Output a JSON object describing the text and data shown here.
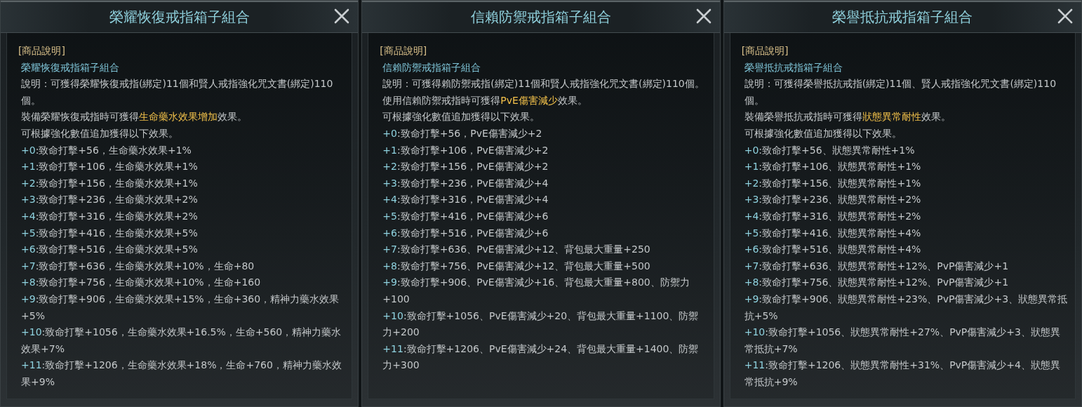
{
  "panels": [
    {
      "title": "榮耀恢復戒指箱子組合",
      "section_heading": "[商品說明]",
      "item_name": "榮耀恢復戒指箱子組合",
      "description": "說明：可獲得榮耀恢復戒指(綁定)11個和賢人戒指強化咒文書(綁定)110個。",
      "effect": {
        "before": "裝備榮耀恢復戒指時可獲得",
        "highlight": "生命藥水效果增加",
        "after": "效果。"
      },
      "note": "可根據強化數值追加獲得以下效果。",
      "levels": [
        {
          "level": "+0",
          "text": ":致命打擊+56，生命藥水效果+1%"
        },
        {
          "level": "+1",
          "text": ":致命打擊+106，生命藥水效果+1%"
        },
        {
          "level": "+2",
          "text": ":致命打擊+156，生命藥水效果+1%"
        },
        {
          "level": "+3",
          "text": ":致命打擊+236，生命藥水效果+2%"
        },
        {
          "level": "+4",
          "text": ":致命打擊+316，生命藥水效果+2%"
        },
        {
          "level": "+5",
          "text": ":致命打擊+416，生命藥水效果+5%"
        },
        {
          "level": "+6",
          "text": ":致命打擊+516，生命藥水效果+5%"
        },
        {
          "level": "+7",
          "text": ":致命打擊+636，生命藥水效果+10%，生命+80"
        },
        {
          "level": "+8",
          "text": ":致命打擊+756，生命藥水效果+10%，生命+160"
        },
        {
          "level": "+9",
          "text": ":致命打擊+906，生命藥水效果+15%，生命+360，精神力藥水效果+5%"
        },
        {
          "level": "+10",
          "text": ":致命打擊+1056，生命藥水效果+16.5%，生命+560，精神力藥水效果+7%"
        },
        {
          "level": "+11",
          "text": ":致命打擊+1206，生命藥水效果+18%，生命+760，精神力藥水效果+9%"
        }
      ]
    },
    {
      "title": "信賴防禦戒指箱子組合",
      "section_heading": "[商品說明]",
      "item_name": "信賴防禦戒指箱子組合",
      "description": "說明：可獲得賴防禦戒指(綁定)11個和賢人戒指強化咒文書(綁定)110個。",
      "effect": {
        "before": "使用信賴防禦戒指時可獲得",
        "highlight": "PvE傷害減少",
        "after": "效果。"
      },
      "note": "可根據強化數值追加獲得以下效果。",
      "levels": [
        {
          "level": "+0",
          "text": ":致命打擊+56，PvE傷害減少+2"
        },
        {
          "level": "+1",
          "text": ":致命打擊+106，PvE傷害減少+2"
        },
        {
          "level": "+2",
          "text": ":致命打擊+156，PvE傷害減少+2"
        },
        {
          "level": "+3",
          "text": ":致命打擊+236，PvE傷害減少+4"
        },
        {
          "level": "+4",
          "text": ":致命打擊+316，PvE傷害減少+4"
        },
        {
          "level": "+5",
          "text": ":致命打擊+416，PvE傷害減少+6"
        },
        {
          "level": "+6",
          "text": ":致命打擊+516，PvE傷害減少+6"
        },
        {
          "level": "+7",
          "text": ":致命打擊+636、PvE傷害減少+12、背包最大重量+250"
        },
        {
          "level": "+8",
          "text": ":致命打擊+756、PvE傷害減少+12、背包最大重量+500"
        },
        {
          "level": "+9",
          "text": ":致命打擊+906、PvE傷害減少+16、背包最大重量+800、防禦力+100"
        },
        {
          "level": "+10",
          "text": ":致命打擊+1056、PvE傷害減少+20、背包最大重量+1100、防禦力+200"
        },
        {
          "level": "+11",
          "text": ":致命打擊+1206、PvE傷害減少+24、背包最大重量+1400、防禦力+300"
        }
      ]
    },
    {
      "title": "榮譽抵抗戒指箱子組合",
      "section_heading": "[商品說明]",
      "item_name": "榮譽抵抗戒指箱子組合",
      "description": "說明：可獲得榮譽抵抗戒指(綁定)11個、賢人戒指強化咒文書(綁定)110個。",
      "effect": {
        "before": "裝備榮譽抵抗戒指時可獲得",
        "highlight": "狀態異常耐性",
        "after": "效果。"
      },
      "note": "可根據強化數值追加獲得以下效果。",
      "levels": [
        {
          "level": "+0",
          "text": ":致命打擊+56、狀態異常耐性+1%"
        },
        {
          "level": "+1",
          "text": ":致命打擊+106、狀態異常耐性+1%"
        },
        {
          "level": "+2",
          "text": ":致命打擊+156、狀態異常耐性+1%"
        },
        {
          "level": "+3",
          "text": ":致命打擊+236、狀態異常耐性+2%"
        },
        {
          "level": "+4",
          "text": ":致命打擊+316、狀態異常耐性+2%"
        },
        {
          "level": "+5",
          "text": ":致命打擊+416、狀態異常耐性+4%"
        },
        {
          "level": "+6",
          "text": ":致命打擊+516、狀態異常耐性+4%"
        },
        {
          "level": "+7",
          "text": ":致命打擊+636、狀態異常耐性+12%、PvP傷害減少+1"
        },
        {
          "level": "+8",
          "text": ":致命打擊+756、狀態異常耐性+12%、PvP傷害減少+1"
        },
        {
          "level": "+9",
          "text": ":致命打擊+906、狀態異常耐性+23%、PvP傷害減少+3、狀態異常抵抗+5%"
        },
        {
          "level": "+10",
          "text": ":致命打擊+1056、狀態異常耐性+27%、PvP傷害減少+3、狀態異常抵抗+7%"
        },
        {
          "level": "+11",
          "text": ":致命打擊+1206、狀態異常耐性+31%、PvP傷害減少+4、狀態異常抵抗+9%"
        }
      ]
    }
  ]
}
